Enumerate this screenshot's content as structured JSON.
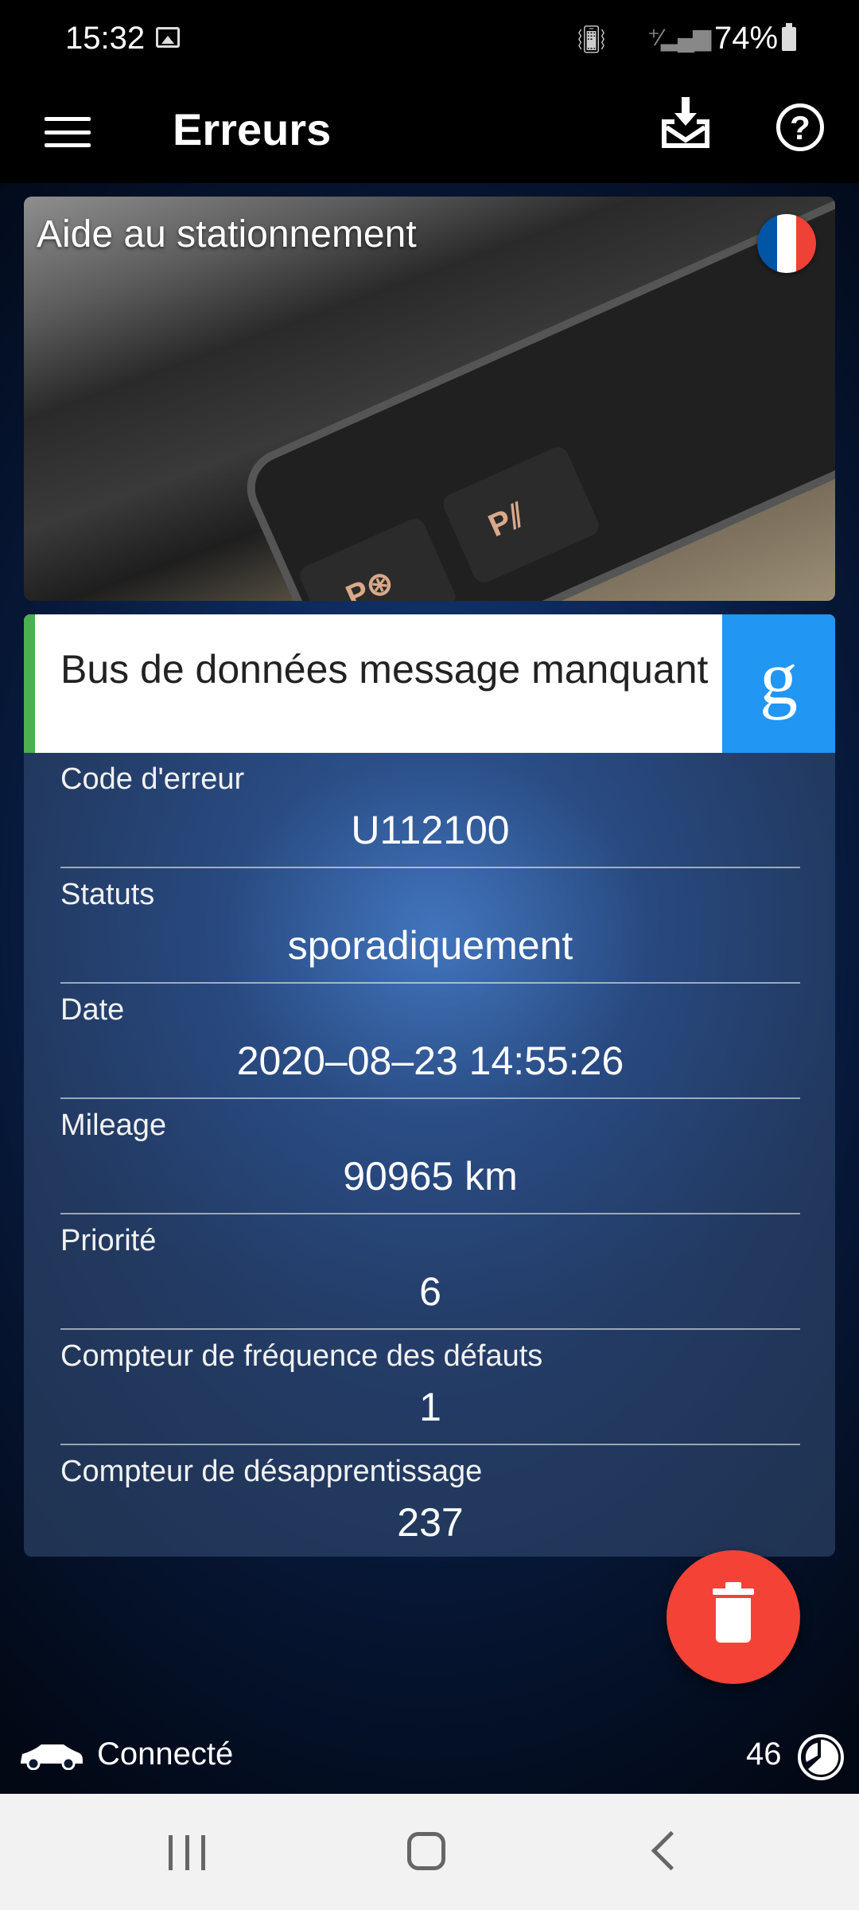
{
  "status_bar": {
    "time": "15:32",
    "battery": "74%",
    "icons": [
      "image-icon",
      "vibrate-icon",
      "signal-icon",
      "battery-icon"
    ]
  },
  "app_bar": {
    "title": "Erreurs",
    "icons": [
      "menu-icon",
      "inbox-download-icon",
      "help-icon"
    ]
  },
  "banner": {
    "title": "Aide au stationnement",
    "flag_colors": [
      "#0055a4",
      "#ffffff",
      "#ef4135"
    ]
  },
  "error": {
    "description": "Bus de données message manquant",
    "search_icon_letter": "g",
    "accent_color": "#4caf50",
    "search_color": "#2196f3"
  },
  "details": [
    {
      "label": "Code d'erreur",
      "value": "U112100"
    },
    {
      "label": "Statuts",
      "value": "sporadiquement"
    },
    {
      "label": "Date",
      "value": "2020–08–23 14:55:26"
    },
    {
      "label": "Mileage",
      "value": "90965 km"
    },
    {
      "label": "Priorité",
      "value": "6"
    },
    {
      "label": "Compteur de fréquence des défauts",
      "value": "1"
    },
    {
      "label": "Compteur de désapprentissage",
      "value": "237"
    }
  ],
  "fab": {
    "icon": "trash-icon",
    "color": "#f44336"
  },
  "footer": {
    "connection_status": "Connecté",
    "count": "46"
  },
  "nav_bar": {
    "icons": [
      "recent-apps-icon",
      "home-icon",
      "back-icon"
    ]
  }
}
